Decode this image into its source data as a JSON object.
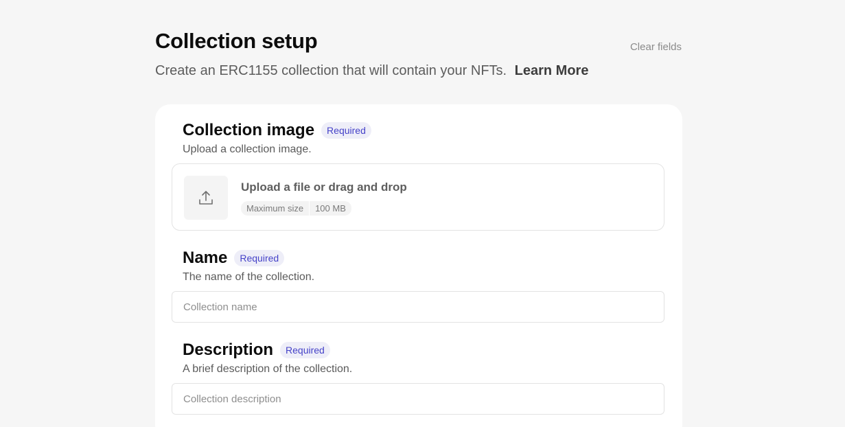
{
  "header": {
    "title": "Collection setup",
    "clear_label": "Clear fields",
    "subtitle": "Create an ERC1155 collection that will contain your NFTs.",
    "learn_more": "Learn More"
  },
  "form": {
    "image": {
      "title": "Collection image",
      "badge": "Required",
      "description": "Upload a collection image.",
      "upload_label": "Upload a file or drag and drop",
      "size_label": "Maximum size",
      "size_value": "100 MB",
      "icon": "upload-icon"
    },
    "name": {
      "title": "Name",
      "badge": "Required",
      "description": "The name of the collection.",
      "placeholder": "Collection name",
      "value": ""
    },
    "description": {
      "title": "Description",
      "badge": "Required",
      "description": "A brief description of the collection.",
      "placeholder": "Collection description",
      "value": ""
    }
  },
  "colors": {
    "background": "#f6f6f6",
    "card": "#ffffff",
    "badge_bg": "#eeeef8",
    "badge_text": "#4542c8"
  }
}
